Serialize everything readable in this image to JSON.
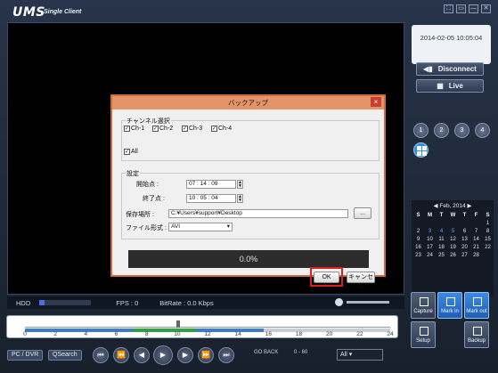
{
  "app": {
    "title": "UMS",
    "subtitle": "Single Client"
  },
  "window_buttons": [
    "⛶",
    "▭",
    "—",
    "✕"
  ],
  "status": {
    "hdd": "HDD",
    "fps": "FPS : 0",
    "bitrate": "BitRate : 0.0 Kbps"
  },
  "timeline": {
    "ticks": [
      "0",
      "2",
      "4",
      "6",
      "8",
      "10",
      "12",
      "14",
      "16",
      "18",
      "20",
      "22",
      "24"
    ]
  },
  "controls": {
    "pc_dvr": "PC / DVR",
    "qsearch": "QSearch",
    "go_back": "GO BACK",
    "speed": "0 - 60",
    "channel_select": "All"
  },
  "clock": "2014-02-05 10:05:04",
  "right": {
    "disconnect": "Disconnect",
    "live": "Live",
    "channels": [
      "1",
      "2",
      "3",
      "4"
    ]
  },
  "calendar": {
    "title": "Feb, 2014",
    "dow": [
      "S",
      "M",
      "T",
      "W",
      "T",
      "F",
      "S"
    ],
    "days": [
      "",
      "",
      "",
      "",
      "",
      "",
      "1",
      "2",
      "3",
      "4",
      "5",
      "6",
      "7",
      "8",
      "9",
      "10",
      "11",
      "12",
      "13",
      "14",
      "15",
      "16",
      "17",
      "18",
      "19",
      "20",
      "21",
      "22",
      "23",
      "24",
      "25",
      "26",
      "27",
      "28",
      ""
    ]
  },
  "tools": {
    "capture": "Capture",
    "mark_in": "Mark in",
    "mark_out": "Mark out",
    "setup": "Setup",
    "backup": "Backup"
  },
  "dialog": {
    "title": "バックアップ",
    "channel_group": "チャンネル選択",
    "channels": [
      "Ch-1",
      "Ch-2",
      "Ch-3",
      "Ch-4"
    ],
    "all": "All",
    "settings_group": "設定",
    "start_label": "開始点 :",
    "start_value": "07 : 14 : 09",
    "end_label": "終了点 :",
    "end_value": "10 : 05 : 04",
    "save_label": "保存場所 :",
    "save_value": "C:¥Users¥support¥Desktop",
    "browse": "...",
    "format_label": "ファイル形式 :",
    "format_value": "AVI",
    "progress_text": "0.0%",
    "ok": "OK",
    "cancel": "キャンセル"
  }
}
